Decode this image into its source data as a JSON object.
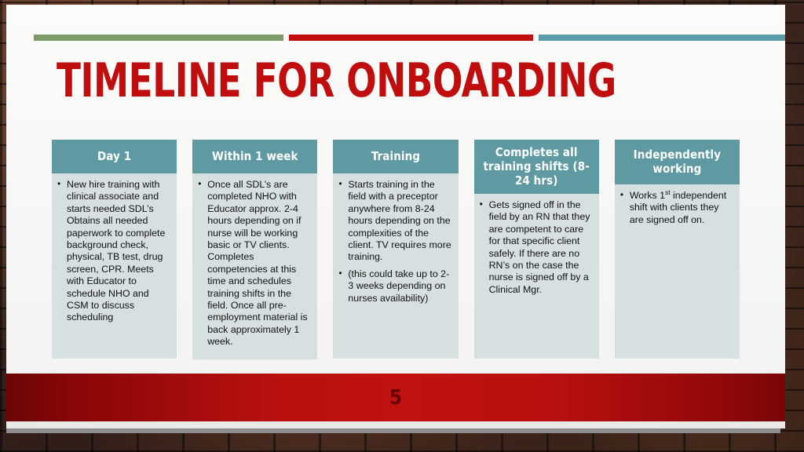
{
  "slide": {
    "title": "Timeline for Onboarding",
    "page_number": "5",
    "accent_colors": {
      "green_rule": "#7e9a68",
      "red_rule": "#c10e0e",
      "teal_rule": "#5d9aa8",
      "title_red": "#c00d0d",
      "header_teal": "#5f9aa3",
      "body_panel": "#d6e0e1",
      "footer_red": "#c21111",
      "page_number_red": "#6b0404"
    }
  },
  "columns": [
    {
      "header": "Day 1",
      "bullets": [
        "New hire training with clinical associate and starts needed SDL’s Obtains all needed paperwork to complete background check, physical, TB test, drug screen, CPR. Meets with Educator to schedule NHO and CSM to discuss scheduling"
      ]
    },
    {
      "header": "Within 1 week",
      "bullets": [
        "Once all SDL’s are completed NHO with Educator approx. 2-4 hours depending on if nurse will be working basic or TV clients. Completes competencies at this time and schedules training shifts in the field. Once all pre-employment material is back approximately 1 week."
      ]
    },
    {
      "header": "Training",
      "bullets": [
        "Starts training in the field with a preceptor anywhere from 8-24 hours depending on the complexities of the client. TV requires more training.",
        "(this could take up to 2-3 weeks depending on nurses availability)"
      ]
    },
    {
      "header": "Completes all training shifts (8-24 hrs)",
      "bullets": [
        "Gets signed off in the field by an RN that they are competent to care for that specific client safely. If there are no RN’s on the case the nurse is signed off by a Clinical Mgr."
      ]
    },
    {
      "header": "Independently working",
      "bullets_rich": [
        {
          "prefix": "Works 1",
          "sup": "st",
          "suffix": " independent shift with clients they are signed off on."
        }
      ]
    }
  ]
}
